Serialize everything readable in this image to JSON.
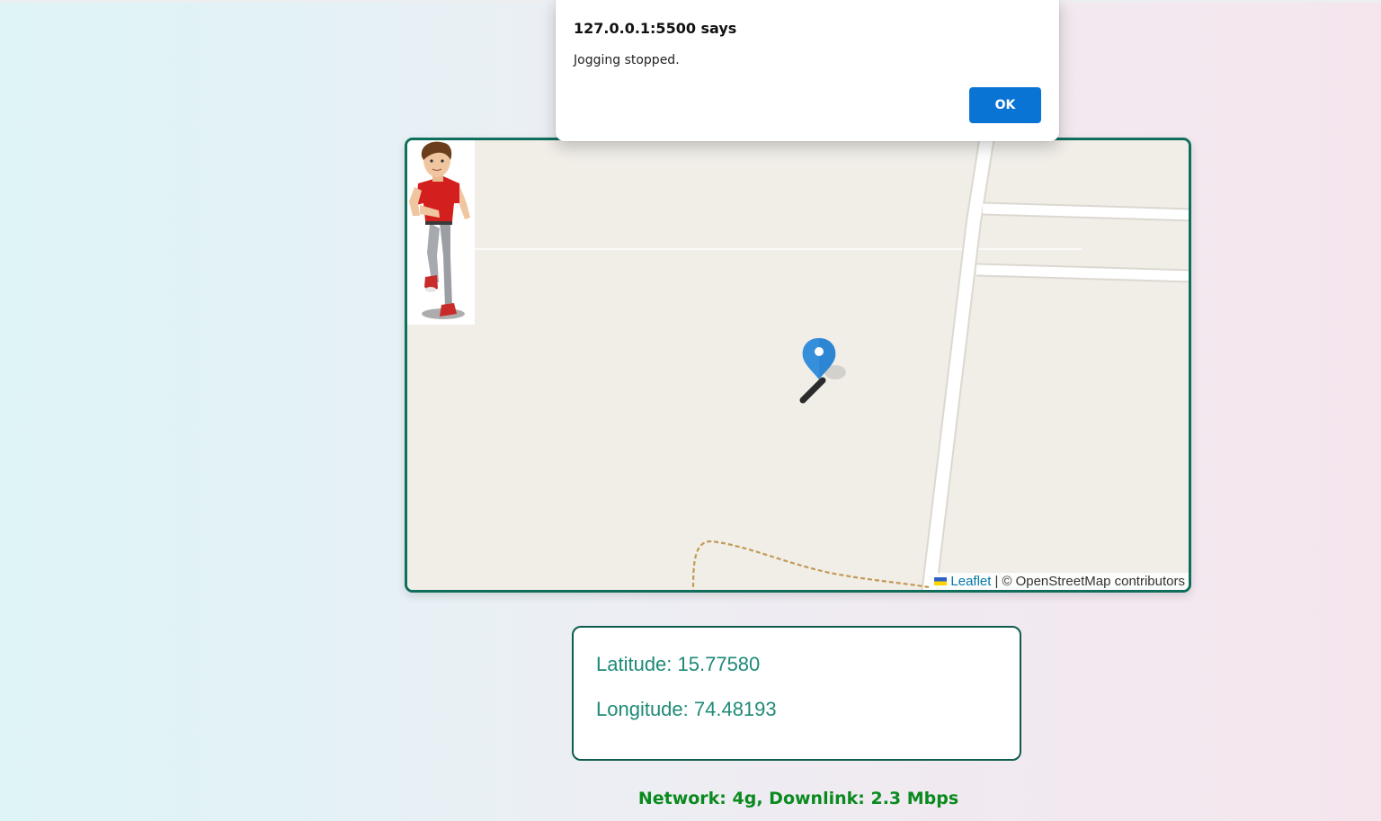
{
  "dialog": {
    "title": "127.0.0.1:5500 says",
    "message": "Jogging stopped.",
    "ok_label": "OK"
  },
  "map": {
    "attribution": {
      "leaflet_label": "Leaflet",
      "separator": "|",
      "osm_text": "© OpenStreetMap contributors"
    },
    "marker_icon": "map-pin-icon",
    "runner_image": "jogging-man"
  },
  "coordinates": {
    "latitude_text": "Latitude: 15.77580",
    "longitude_text": "Longitude: 74.48193"
  },
  "network": {
    "status_text": "Network: 4g, Downlink: 2.3 Mbps"
  },
  "colors": {
    "map_border": "#0f6e5c",
    "coord_text": "#1f8a78",
    "network_text": "#0a8a1e",
    "ok_button": "#0a74d4",
    "map_background": "#f1eee8"
  }
}
